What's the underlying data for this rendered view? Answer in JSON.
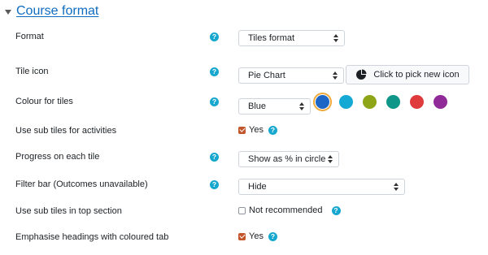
{
  "section": {
    "title": "Course format"
  },
  "rows": {
    "format": {
      "label": "Format",
      "value": "Tiles format"
    },
    "tile_icon": {
      "label": "Tile icon",
      "value": "Pie Chart",
      "button_label": "Click to pick new icon"
    },
    "colour": {
      "label": "Colour for tiles",
      "value": "Blue",
      "swatches": [
        "#1d66c6",
        "#14a8d4",
        "#8da517",
        "#0e9788",
        "#df3a3c",
        "#8f2a98"
      ],
      "selected_index": 0
    },
    "sub_tiles": {
      "label": "Use sub tiles for activities",
      "value": "Yes",
      "checked": true
    },
    "progress": {
      "label": "Progress on each tile",
      "value": "Show as % in circle"
    },
    "filter_bar": {
      "label": "Filter bar (Outcomes unavailable)",
      "value": "Hide"
    },
    "sub_tiles_top": {
      "label": "Use sub tiles in top section",
      "value": "Not recommended",
      "checked": false
    },
    "emphasise": {
      "label": "Emphasise headings with coloured tab",
      "value": "Yes",
      "checked": true
    }
  },
  "help_glyph": "?",
  "accent_colors": {
    "link": "#0f6cbf",
    "help": "#16a7cf",
    "checkbox": "#c2552a",
    "selected_ring": "#f0a93b"
  }
}
